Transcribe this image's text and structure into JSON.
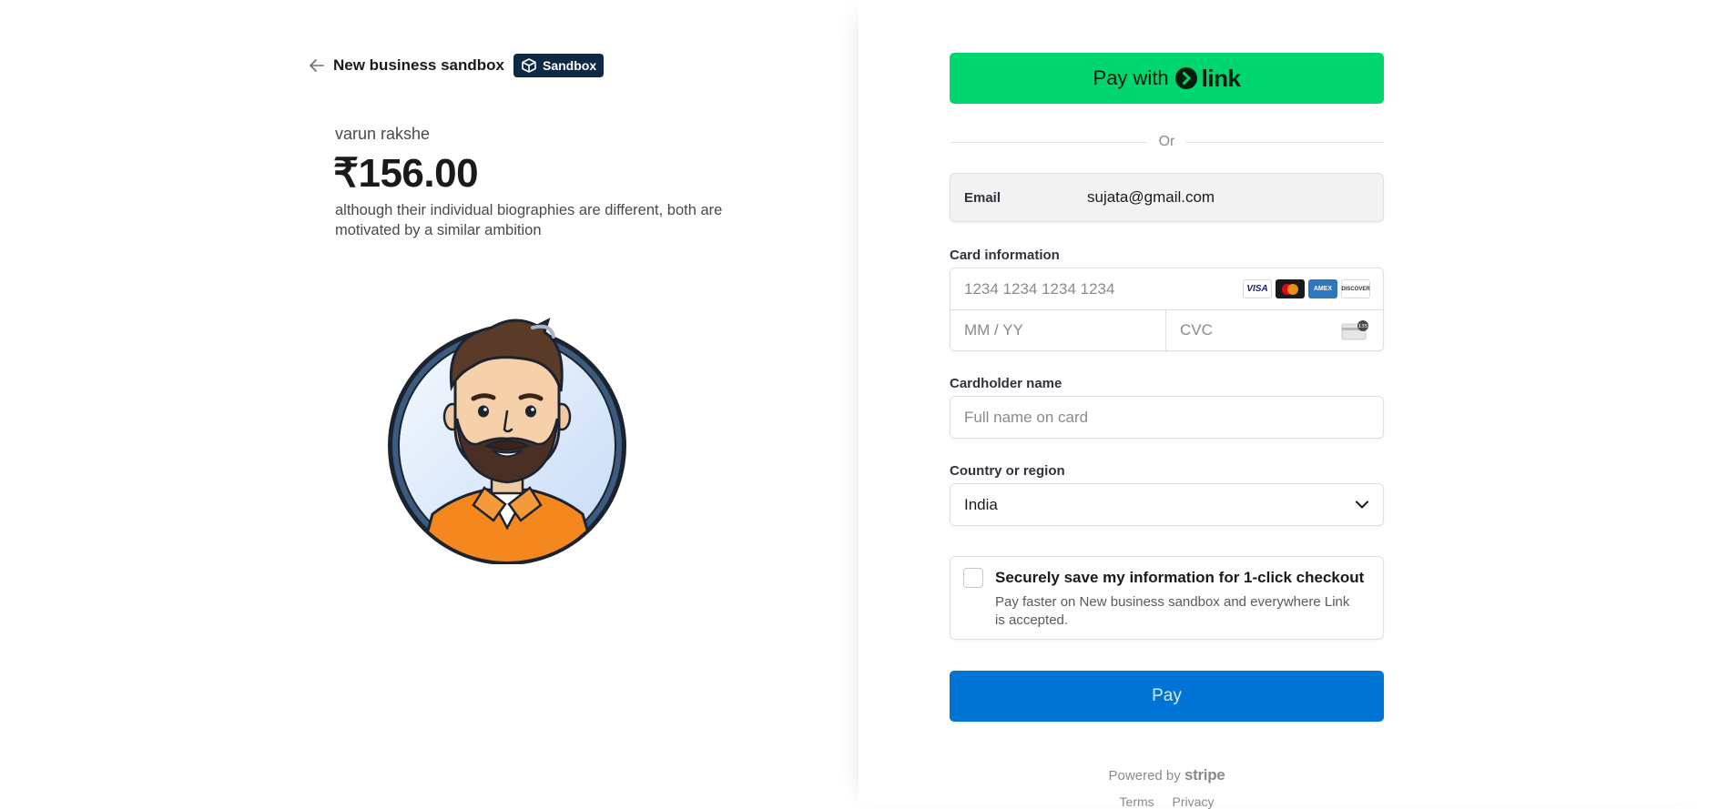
{
  "merchant": {
    "business_name": "New business sandbox",
    "sandbox_badge": "Sandbox"
  },
  "product": {
    "name": "varun rakshe",
    "price": "₹156.00",
    "description": "although their individual biographies are different, both are motivated by a similar ambition"
  },
  "payment": {
    "link_button_prefix": "Pay with",
    "link_brand": "link",
    "divider_text": "Or",
    "email_label": "Email",
    "email_value": "sujata@gmail.com",
    "card_label": "Card information",
    "card_number_placeholder": "1234 1234 1234 1234",
    "card_brands": [
      "VISA",
      "mastercard",
      "AMEX",
      "DISCOVER"
    ],
    "expiry_placeholder": "MM / YY",
    "cvc_placeholder": "CVC",
    "cardholder_label": "Cardholder name",
    "cardholder_placeholder": "Full name on card",
    "country_label": "Country or region",
    "country_value": "India",
    "save_title": "Securely save my information for 1-click checkout",
    "save_subtitle": "Pay faster on New business sandbox and everywhere Link is accepted.",
    "pay_button": "Pay"
  },
  "footer": {
    "powered_by": "Powered by",
    "stripe": "stripe",
    "terms": "Terms",
    "privacy": "Privacy"
  },
  "colors": {
    "link_green": "#00d66f",
    "pay_blue": "#0074d4",
    "badge_navy": "#0f2945"
  }
}
